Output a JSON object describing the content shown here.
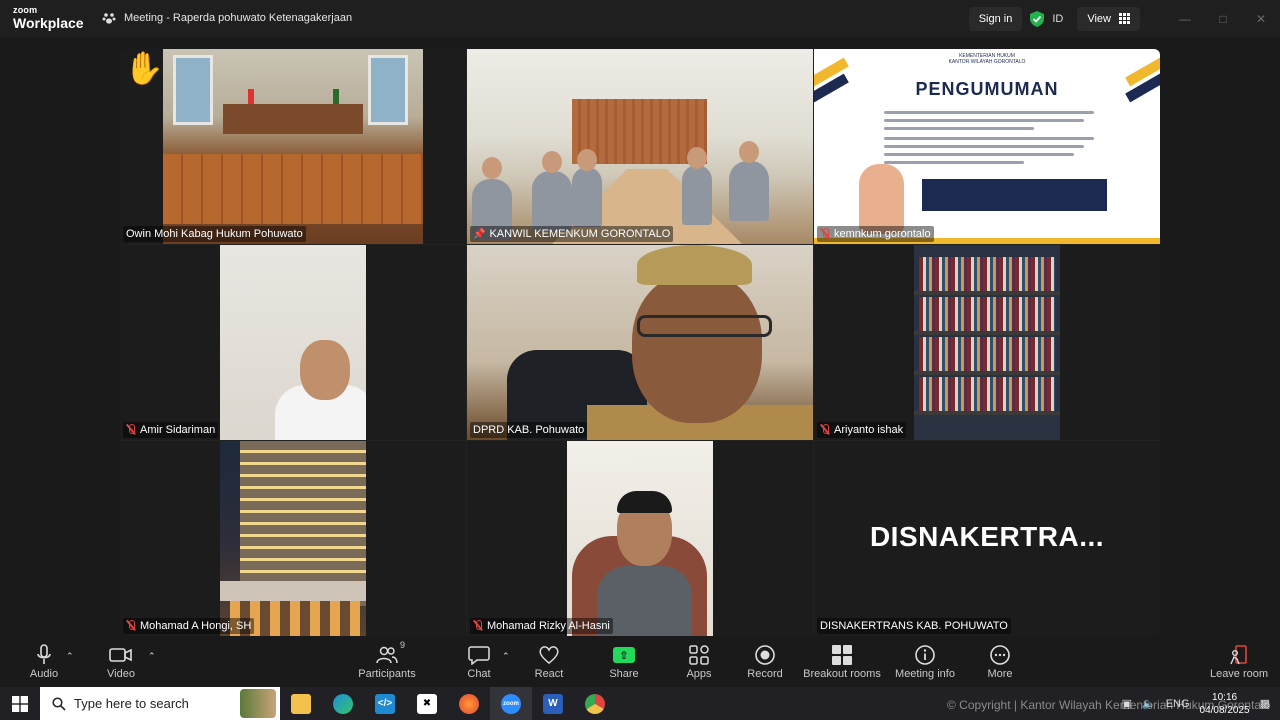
{
  "app": {
    "brand_top": "zoom",
    "brand_bottom": "Workplace",
    "meeting_title": "Meeting - Raperda pohuwato Ketenagakerjaan"
  },
  "titlebar": {
    "sign_in": "Sign in",
    "id_label": "ID",
    "view_label": "View"
  },
  "tiles": [
    {
      "name": "Owin Mohi Kabag Hukum Pohuwato",
      "muted": false,
      "hand_raised": true
    },
    {
      "name": "KANWIL KEMENKUM GORONTALO",
      "muted": false,
      "pinned": true,
      "active_speaker": true
    },
    {
      "name": "kemnkum gorontalo",
      "muted": true
    },
    {
      "name": "Amir Sidariman",
      "muted": true
    },
    {
      "name": "DPRD KAB. Pohuwato",
      "muted": false
    },
    {
      "name": "Ariyanto ishak",
      "muted": true
    },
    {
      "name": "Mohamad A Hongi, SH",
      "muted": true
    },
    {
      "name": "Mohamad Rizky Al-Hasni",
      "muted": true
    },
    {
      "name": "DISNAKERTRANS KAB. POHUWATO",
      "display_text": "DISNAKERTRA...",
      "muted": false
    }
  ],
  "announcement": {
    "org_line1": "KEMENTERIAN HUKUM",
    "org_line2": "KANTOR WILAYAH GORONTALO",
    "heading": "PENGUMUMAN"
  },
  "toolbar": {
    "audio": "Audio",
    "video": "Video",
    "participants": "Participants",
    "participants_count": "9",
    "chat": "Chat",
    "react": "React",
    "share": "Share",
    "apps": "Apps",
    "record": "Record",
    "breakout": "Breakout rooms",
    "meeting_info": "Meeting info",
    "more": "More",
    "leave": "Leave room"
  },
  "taskbar": {
    "search_placeholder": "Type here to search",
    "copyright": "© Copyright | Kantor Wilayah Kementerian Hukum Gorontalo",
    "language": "ENG",
    "time": "10:16",
    "date": "04/08/2025"
  },
  "colors": {
    "active_speaker": "#23d959",
    "muted_icon": "#e0443e",
    "share": "#23d959",
    "leave": "#e0443e"
  }
}
